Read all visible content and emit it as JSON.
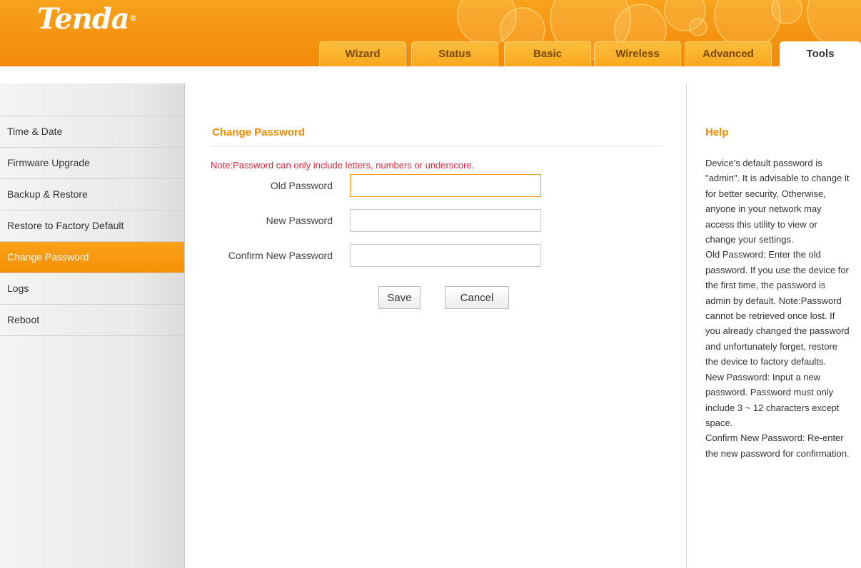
{
  "brand": {
    "logo": "Tenda",
    "registered": "®"
  },
  "tabs": [
    {
      "label": "Wizard",
      "active": false
    },
    {
      "label": "Status",
      "active": false
    },
    {
      "label": "Basic",
      "active": false
    },
    {
      "label": "Wireless",
      "active": false
    },
    {
      "label": "Advanced",
      "active": false
    },
    {
      "label": "Tools",
      "active": true
    }
  ],
  "sidebar": {
    "items": [
      {
        "label": "Time & Date",
        "active": false
      },
      {
        "label": "Firmware Upgrade",
        "active": false
      },
      {
        "label": "Backup & Restore",
        "active": false
      },
      {
        "label": "Restore to Factory Default",
        "active": false
      },
      {
        "label": "Change Password",
        "active": true
      },
      {
        "label": "Logs",
        "active": false
      },
      {
        "label": "Reboot",
        "active": false
      }
    ]
  },
  "main": {
    "title": "Change Password",
    "note": "Note:Password can only include letters, numbers or underscore.",
    "fields": [
      {
        "label": "Old Password",
        "value": "",
        "placeholder": ""
      },
      {
        "label": "New Password",
        "value": "",
        "placeholder": ""
      },
      {
        "label": "Confirm New Password",
        "value": "",
        "placeholder": ""
      }
    ],
    "save_label": "Save",
    "cancel_label": "Cancel"
  },
  "help": {
    "title": "Help",
    "paragraphs": [
      "Device's default password is \"admin\". It is advisable to change it for better security. Otherwise, anyone in your network may access this utility to view or change your settings.",
      "Old Password: Enter the old password. If you use the device for the first time, the password is admin by default. Note:Password cannot be retrieved once lost. If you already changed the password and unfortunately forget, restore the device to factory defaults.",
      "New Password: Input a new password. Password must only include 3 ~ 12 characters except space.",
      "Confirm New Password: Re-enter the new password for confirmation."
    ]
  },
  "colors": {
    "brand_orange": "#f5930f",
    "title_orange": "#f08c00",
    "note_red": "#e8243a",
    "active_sidebar": "#f69005"
  }
}
